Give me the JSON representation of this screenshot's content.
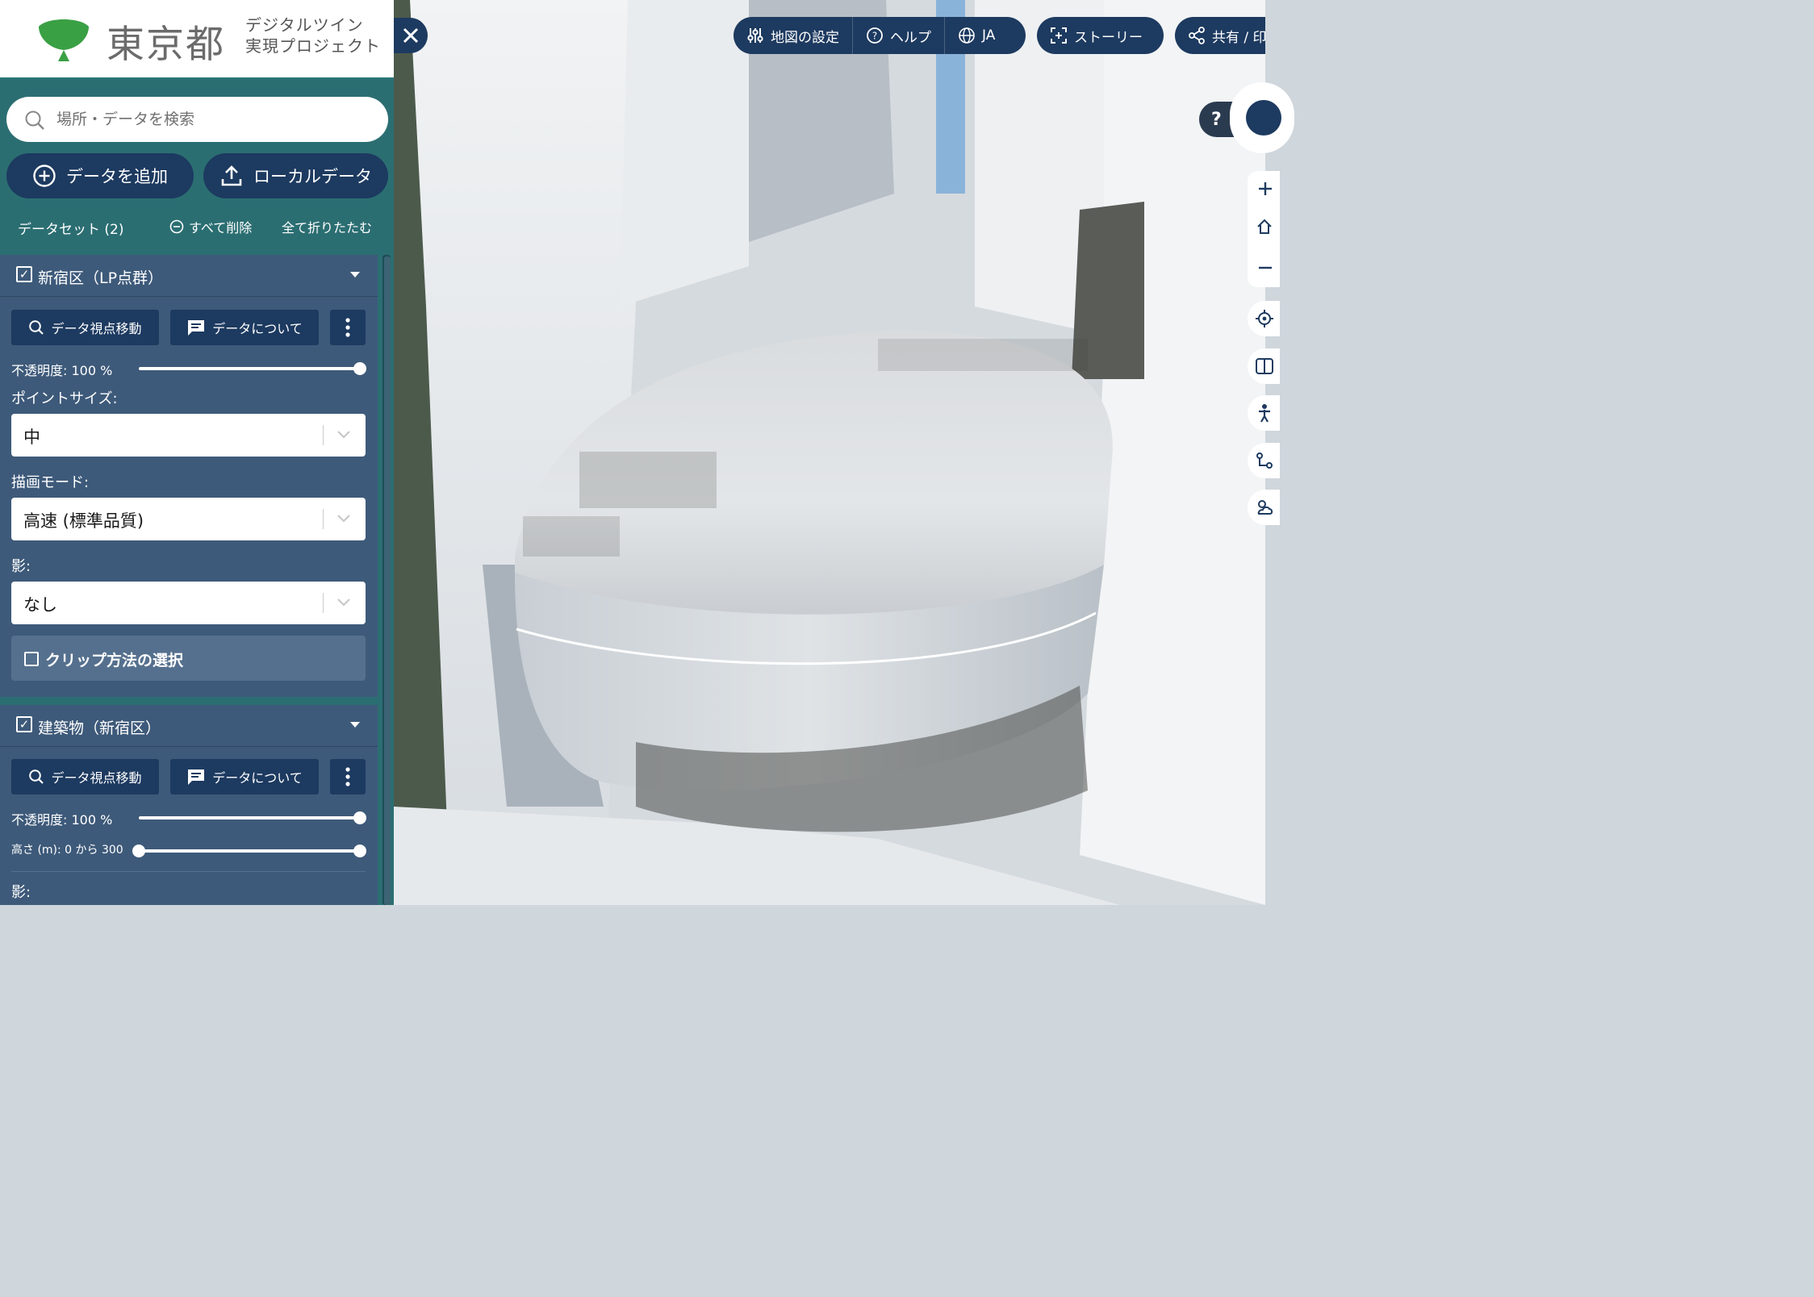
{
  "brand": {
    "name": "東京都",
    "subtitle_line1": "デジタルツイン",
    "subtitle_line2": "実現プロジェクト",
    "leaf_color": "#3aa044"
  },
  "search": {
    "placeholder": "場所・データを検索",
    "value": ""
  },
  "actions": {
    "add_data": "データを追加",
    "local_data": "ローカルデータ"
  },
  "datasets_bar": {
    "count_label": "データセット (2)",
    "remove_all": "すべて削除",
    "collapse_all": "全て折りたたむ"
  },
  "datasets": [
    {
      "title": "新宿区（LP点群）",
      "checked": true,
      "zoom_button": "データ視点移動",
      "about_button": "データについて",
      "opacity_label": "不透明度: 100 %",
      "opacity": 1.0,
      "point_size_label": "ポイントサイズ:",
      "point_size_value": "中",
      "render_mode_label": "描画モード:",
      "render_mode_value": "高速 (標準品質)",
      "shadow_label": "影:",
      "shadow_value": "なし",
      "clip_label": "クリップ方法の選択",
      "clip_checked": false
    },
    {
      "title": "建築物（新宿区）",
      "checked": true,
      "zoom_button": "データ視点移動",
      "about_button": "データについて",
      "opacity_label": "不透明度: 100 %",
      "opacity": 1.0,
      "height_label": "高さ (m): 0 から 300",
      "height_range": [
        0,
        300
      ],
      "shadow_label": "影:"
    }
  ],
  "map_toolbar": {
    "map_settings": "地図の設定",
    "help": "ヘルプ",
    "language": "JA",
    "story": "ストーリー",
    "share": "共有 / 印"
  },
  "map_controls": {
    "help_bubble": "?"
  },
  "colors": {
    "panel_bg": "#2b6e72",
    "card_bg": "#3e5a7a",
    "button_bg": "#1d3a60"
  }
}
